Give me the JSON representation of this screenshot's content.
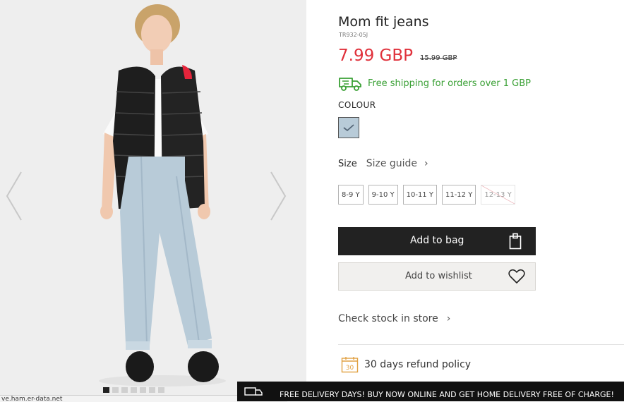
{
  "product": {
    "title": "Mom fit jeans",
    "sku": "TR932-05J",
    "price": "7.99 GBP",
    "old_price": "15.99 GBP",
    "shipping_text": "Free shipping for orders over 1 GBP",
    "shipping_color": "#3aa035",
    "price_color": "#e0303a"
  },
  "colour": {
    "label": "COLOUR",
    "selected_swatch": "light blue denim",
    "swatch_color": "#b8cbd8"
  },
  "size": {
    "label": "Size",
    "guide_label": "Size guide",
    "options": [
      {
        "label": "8-9 Y",
        "available": true
      },
      {
        "label": "9-10 Y",
        "available": true
      },
      {
        "label": "10-11 Y",
        "available": true
      },
      {
        "label": "11-12 Y",
        "available": true
      },
      {
        "label": "12-13 Y",
        "available": false
      }
    ]
  },
  "actions": {
    "add_to_bag": "Add to bag",
    "add_to_wishlist": "Add to wishlist",
    "check_stock": "Check stock in store"
  },
  "policy": {
    "refund_text": "30 days refund policy",
    "refund_icon_text": "30"
  },
  "promo": {
    "text": "FREE DELIVERY DAYS! BUY NOW ONLINE AND GET HOME DELIVERY FREE OF CHARGE!"
  },
  "gallery": {
    "total_images": 7,
    "active_index": 0
  },
  "statusbar": {
    "text": "ve.ham.er-data.net"
  }
}
